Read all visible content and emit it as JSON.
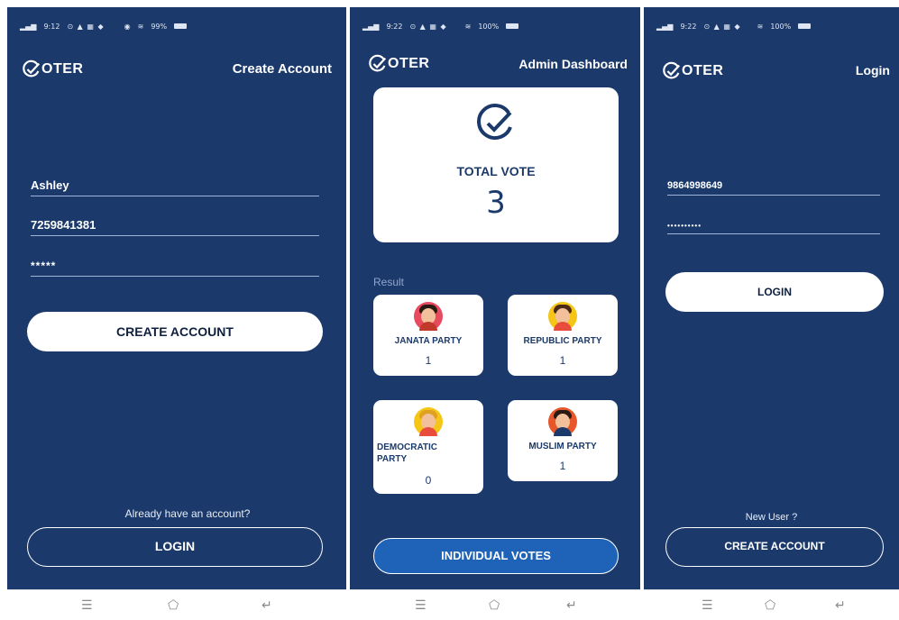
{
  "status_bar": {
    "screen1": {
      "time": "9:12",
      "battery": "99%"
    },
    "screen2": {
      "time": "9:22",
      "battery": "100%"
    },
    "screen3": {
      "time": "9:22",
      "battery": "100%"
    }
  },
  "logo_text": "OTER",
  "create_account": {
    "title": "Create Account",
    "name_value": "Ashley",
    "phone_value": "7259841381",
    "password_value": "*****",
    "create_button": "CREATE ACCOUNT",
    "prompt": "Already have an account?",
    "login_button": "LOGIN"
  },
  "admin_dashboard": {
    "title": "Admin Dashboard",
    "total_label": "TOTAL VOTE",
    "total_value": "3",
    "result_label": "Result",
    "parties": [
      {
        "name": "JANATA PARTY",
        "votes": "1",
        "avatar_color": "#e84a5f"
      },
      {
        "name": "REPUBLIC PARTY",
        "votes": "1",
        "avatar_color": "#f5c518"
      },
      {
        "name": "DEMOCRATIC PARTY",
        "votes": "0",
        "avatar_color": "#f5c518"
      },
      {
        "name": "MUSLIM PARTY",
        "votes": "1",
        "avatar_color": "#e8572a"
      }
    ],
    "individual_votes_button": "INDIVIDUAL VOTES"
  },
  "login": {
    "title": "Login",
    "phone_value": "9864998649",
    "password_value": "••••••••••",
    "login_button": "LOGIN",
    "prompt": "New User ?",
    "create_button": "CREATE ACCOUNT"
  },
  "nav_icons": [
    "menu-icon",
    "home-icon",
    "back-icon"
  ],
  "colors": {
    "background": "#1b3a6b",
    "accent_button": "#1e63b8",
    "card": "#ffffff"
  }
}
